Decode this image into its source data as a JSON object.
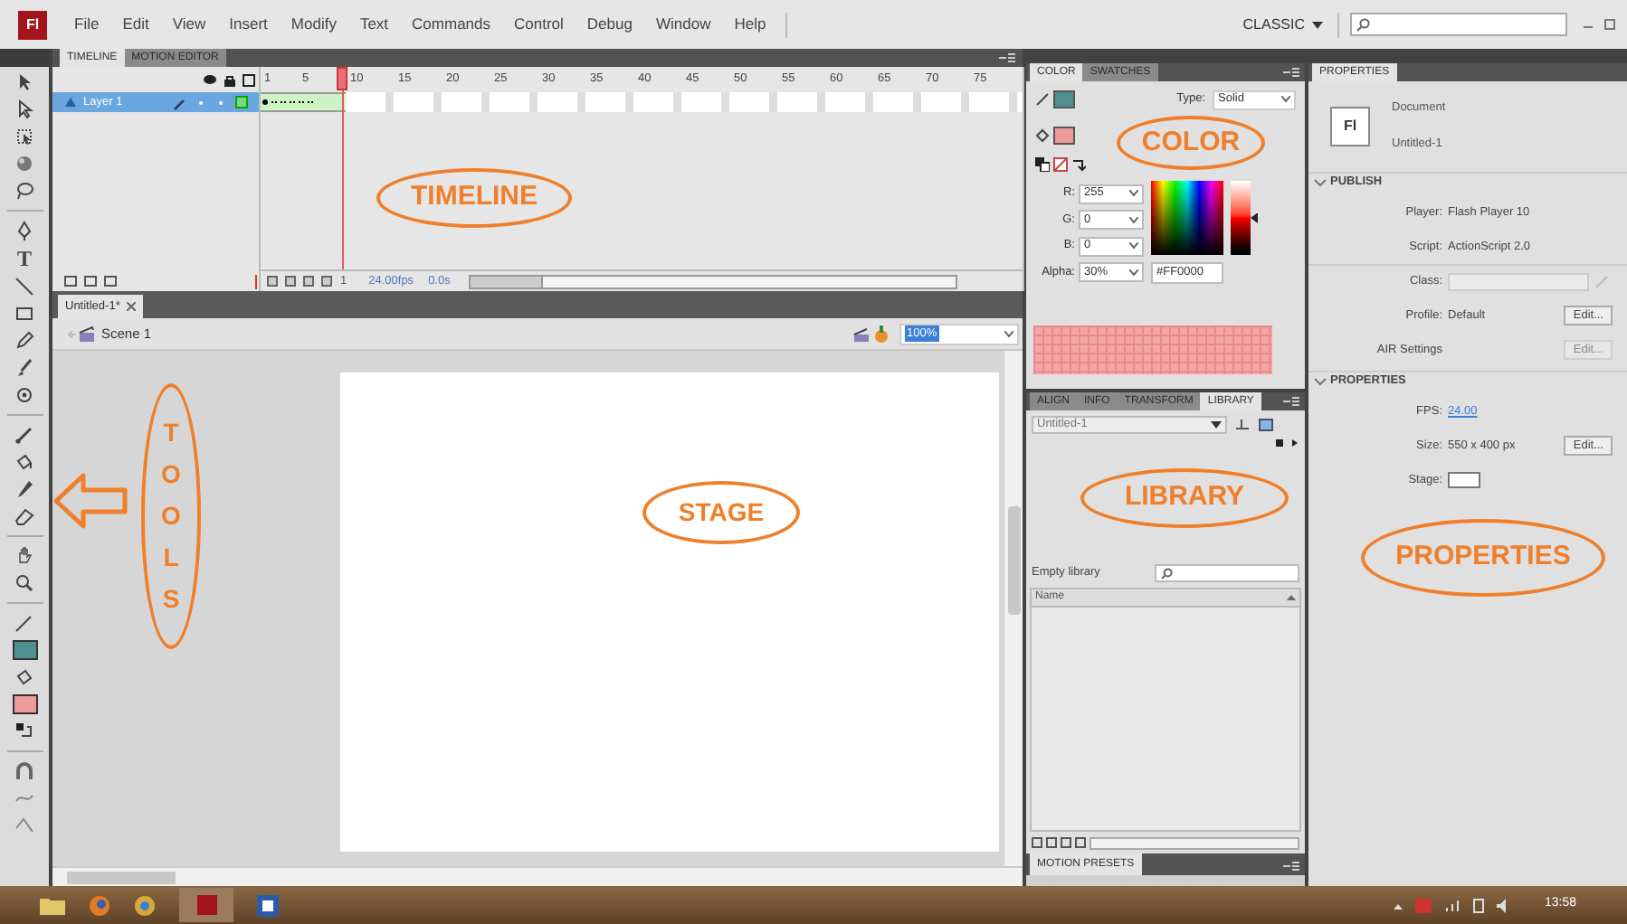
{
  "menu_bar": {
    "logo": "Fl",
    "items": [
      "File",
      "Edit",
      "View",
      "Insert",
      "Modify",
      "Text",
      "Commands",
      "Control",
      "Debug",
      "Window",
      "Help"
    ],
    "workspace": "CLASSIC"
  },
  "tools": {
    "text_tool": "T"
  },
  "timeline": {
    "tabs": [
      {
        "label": "TIMELINE",
        "selected": true
      },
      {
        "label": "MOTION EDITOR",
        "selected": false
      }
    ],
    "frame_numbers": [
      "1",
      "5",
      "10",
      "15",
      "20",
      "25",
      "30",
      "35",
      "40",
      "45",
      "50",
      "55",
      "60",
      "65",
      "70",
      "75"
    ],
    "layers": [
      {
        "name": "Layer 1",
        "selected": true
      }
    ],
    "current_frame": "1",
    "frame_rate": "24.00fps",
    "elapsed": "0.0s"
  },
  "document": {
    "tabs": [
      {
        "label": "Untitled-1*",
        "selected": true
      }
    ],
    "scene": "Scene 1",
    "zoom": "100%"
  },
  "color_panel": {
    "tabs": [
      {
        "label": "COLOR",
        "selected": true
      },
      {
        "label": "SWATCHES",
        "selected": false
      }
    ],
    "type_label": "Type:",
    "type": "Solid",
    "channels": [
      {
        "label": "R:",
        "value": "255"
      },
      {
        "label": "G:",
        "value": "0"
      },
      {
        "label": "B:",
        "value": "0"
      },
      {
        "label": "Alpha:",
        "value": "30%"
      }
    ],
    "hex": "#FF0000",
    "brightness": {
      "level": 0.5
    }
  },
  "library": {
    "tabs": [
      {
        "label": "ALIGN",
        "selected": false
      },
      {
        "label": "INFO",
        "selected": false
      },
      {
        "label": "TRANSFORM",
        "selected": false
      },
      {
        "label": "LIBRARY",
        "selected": true
      }
    ],
    "document": "Untitled-1",
    "status": "Empty library",
    "columns": [
      "Name"
    ]
  },
  "motion_presets": {
    "tabs": [
      {
        "label": "MOTION PRESETS",
        "selected": true
      }
    ]
  },
  "properties": {
    "tabs": [
      {
        "label": "PROPERTIES",
        "selected": true
      }
    ],
    "doc_icon": "Fl",
    "doc_type": "Document",
    "doc_name": "Untitled-1",
    "sections": [
      {
        "title": "PUBLISH",
        "expanded": true,
        "rows": [
          {
            "kind": "text",
            "label": "Player:",
            "value": "Flash Player 10"
          },
          {
            "kind": "text",
            "label": "Script:",
            "value": "ActionScript 2.0"
          },
          {
            "kind": "field",
            "label": "Class:"
          },
          {
            "kind": "text",
            "label": "Profile:",
            "value": "Default",
            "button": {
              "label": "Edit...",
              "disabled": false
            }
          },
          {
            "kind": "text",
            "label": "AIR Settings",
            "button": {
              "label": "Edit...",
              "disabled": true
            }
          }
        ]
      },
      {
        "title": "PROPERTIES",
        "expanded": true,
        "rows": [
          {
            "kind": "link",
            "label": "FPS:",
            "value": "24.00"
          },
          {
            "kind": "text",
            "label": "Size:",
            "value": "550 x 400 px",
            "button": {
              "label": "Edit...",
              "disabled": false
            }
          },
          {
            "kind": "swatch",
            "label": "Stage:"
          }
        ]
      }
    ]
  },
  "annotations": [
    {
      "label": "TIMELINE",
      "kind": "ellipse"
    },
    {
      "label": "COLOR",
      "kind": "ellipse"
    },
    {
      "label": "STAGE",
      "kind": "ellipse"
    },
    {
      "label": "LIBRARY",
      "kind": "ellipse"
    },
    {
      "label": "PROPERTIES",
      "kind": "ellipse"
    },
    {
      "label": "TOOLS",
      "kind": "vertical"
    }
  ],
  "taskbar": {
    "clock": "13:58"
  }
}
